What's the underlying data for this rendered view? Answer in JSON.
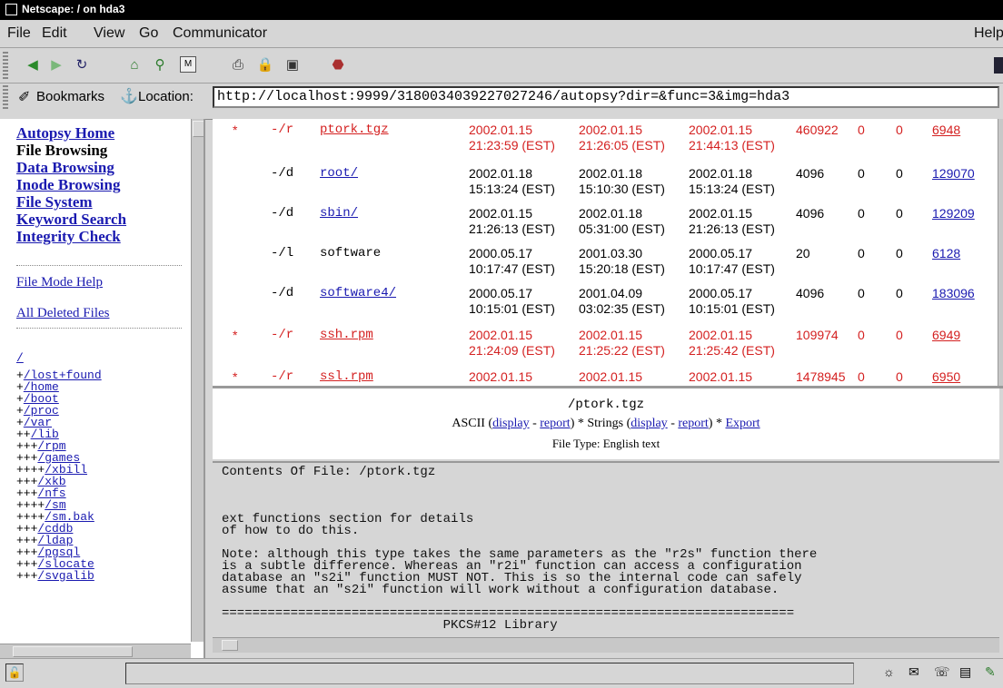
{
  "window": {
    "title": "Netscape: / on hda3"
  },
  "menu": [
    "File",
    "Edit",
    "View",
    "Go",
    "Communicator",
    "Help"
  ],
  "toolbar": {
    "icons": [
      "back-icon",
      "forward-icon",
      "reload-icon",
      "home-icon",
      "search-icon",
      "my-netscape-icon",
      "print-icon",
      "security-icon",
      "shop-icon",
      "stop-icon"
    ]
  },
  "location": {
    "bookmarks_label": "Bookmarks",
    "location_label": "Location:",
    "url": "http://localhost:9999/3180034039227027246/autopsy?dir=&func=3&img=hda3"
  },
  "nav": {
    "links": [
      "Autopsy Home",
      "File Browsing",
      "Data Browsing",
      "Inode Browsing",
      "File System",
      "Keyword Search",
      "Integrity Check"
    ],
    "current": "File Browsing",
    "help": "File Mode Help",
    "deleted": "All Deleted Files",
    "root": "/",
    "tree": [
      [
        "+",
        "/lost+found"
      ],
      [
        "+",
        "/home"
      ],
      [
        "+",
        "/boot"
      ],
      [
        "+",
        "/proc"
      ],
      [
        "+",
        "/var"
      ],
      [
        "++",
        "/lib"
      ],
      [
        "+++",
        "/rpm"
      ],
      [
        "+++",
        "/games"
      ],
      [
        "++++",
        "/xbill"
      ],
      [
        "+++",
        "/xkb"
      ],
      [
        "+++",
        "/nfs"
      ],
      [
        "++++",
        "/sm"
      ],
      [
        "++++",
        "/sm.bak"
      ],
      [
        "+++",
        "/cddb"
      ],
      [
        "+++",
        "/ldap"
      ],
      [
        "+++",
        "/pgsql"
      ],
      [
        "+++",
        "/slocate"
      ],
      [
        "+++",
        "/svgalib"
      ]
    ]
  },
  "files": [
    {
      "del": "*",
      "type": "-/r",
      "name": "ptork.tgz",
      "link": true,
      "m": [
        "2002.01.15",
        "21:23:59 (EST)"
      ],
      "a": [
        "2002.01.15",
        "21:26:05 (EST)"
      ],
      "c": [
        "2002.01.15",
        "21:44:13 (EST)"
      ],
      "size": "460922",
      "uid": "0",
      "gid": "0",
      "inode": "6948"
    },
    {
      "del": "",
      "type": "-/d",
      "name": "root/",
      "link": true,
      "m": [
        "2002.01.18",
        "15:13:24 (EST)"
      ],
      "a": [
        "2002.01.18",
        "15:10:30 (EST)"
      ],
      "c": [
        "2002.01.18",
        "15:13:24 (EST)"
      ],
      "size": "4096",
      "uid": "0",
      "gid": "0",
      "inode": "129070"
    },
    {
      "del": "",
      "type": "-/d",
      "name": "sbin/",
      "link": true,
      "m": [
        "2002.01.15",
        "21:26:13 (EST)"
      ],
      "a": [
        "2002.01.18",
        "05:31:00 (EST)"
      ],
      "c": [
        "2002.01.15",
        "21:26:13 (EST)"
      ],
      "size": "4096",
      "uid": "0",
      "gid": "0",
      "inode": "129209"
    },
    {
      "del": "",
      "type": "-/l",
      "name": "software",
      "link": false,
      "m": [
        "2000.05.17",
        "10:17:47 (EST)"
      ],
      "a": [
        "2001.03.30",
        "15:20:18 (EST)"
      ],
      "c": [
        "2000.05.17",
        "10:17:47 (EST)"
      ],
      "size": "20",
      "uid": "0",
      "gid": "0",
      "inode": "6128"
    },
    {
      "del": "",
      "type": "-/d",
      "name": "software4/",
      "link": true,
      "m": [
        "2000.05.17",
        "10:15:01 (EST)"
      ],
      "a": [
        "2001.04.09",
        "03:02:35 (EST)"
      ],
      "c": [
        "2000.05.17",
        "10:15:01 (EST)"
      ],
      "size": "4096",
      "uid": "0",
      "gid": "0",
      "inode": "183096"
    },
    {
      "del": "*",
      "type": "-/r",
      "name": "ssh.rpm",
      "link": true,
      "m": [
        "2002.01.15",
        "21:24:09 (EST)"
      ],
      "a": [
        "2002.01.15",
        "21:25:22 (EST)"
      ],
      "c": [
        "2002.01.15",
        "21:25:42 (EST)"
      ],
      "size": "109974",
      "uid": "0",
      "gid": "0",
      "inode": "6949"
    },
    {
      "del": "*",
      "type": "-/r",
      "name": "ssl.rpm",
      "link": true,
      "m": [
        "2002.01.15",
        ""
      ],
      "a": [
        "2002.01.15",
        ""
      ],
      "c": [
        "2002.01.15",
        ""
      ],
      "size": "1478945",
      "uid": "0",
      "gid": "0",
      "inode": "6950"
    }
  ],
  "fileview": {
    "filename": "/ptork.tgz",
    "ascii": "ASCII",
    "display": "display",
    "report": "report",
    "strings": "Strings",
    "export": "Export",
    "filetype": "File Type: English text"
  },
  "contents": "Contents Of File: /ptork.tgz\n\n\n\next functions section for details\nof how to do this.\n\nNote: although this type takes the same parameters as the \"r2s\" function there\nis a subtle difference. Whereas an \"r2i\" function can access a configuration\ndatabase an \"s2i\" function MUST NOT. This is so the internal code can safely\nassume that an \"s2i\" function will work without a configuration database.\n\n===========================================================================\n                             PKCS#12 Library",
  "colors": {
    "deleted": "#d42020",
    "link": "#1a1ab0"
  }
}
